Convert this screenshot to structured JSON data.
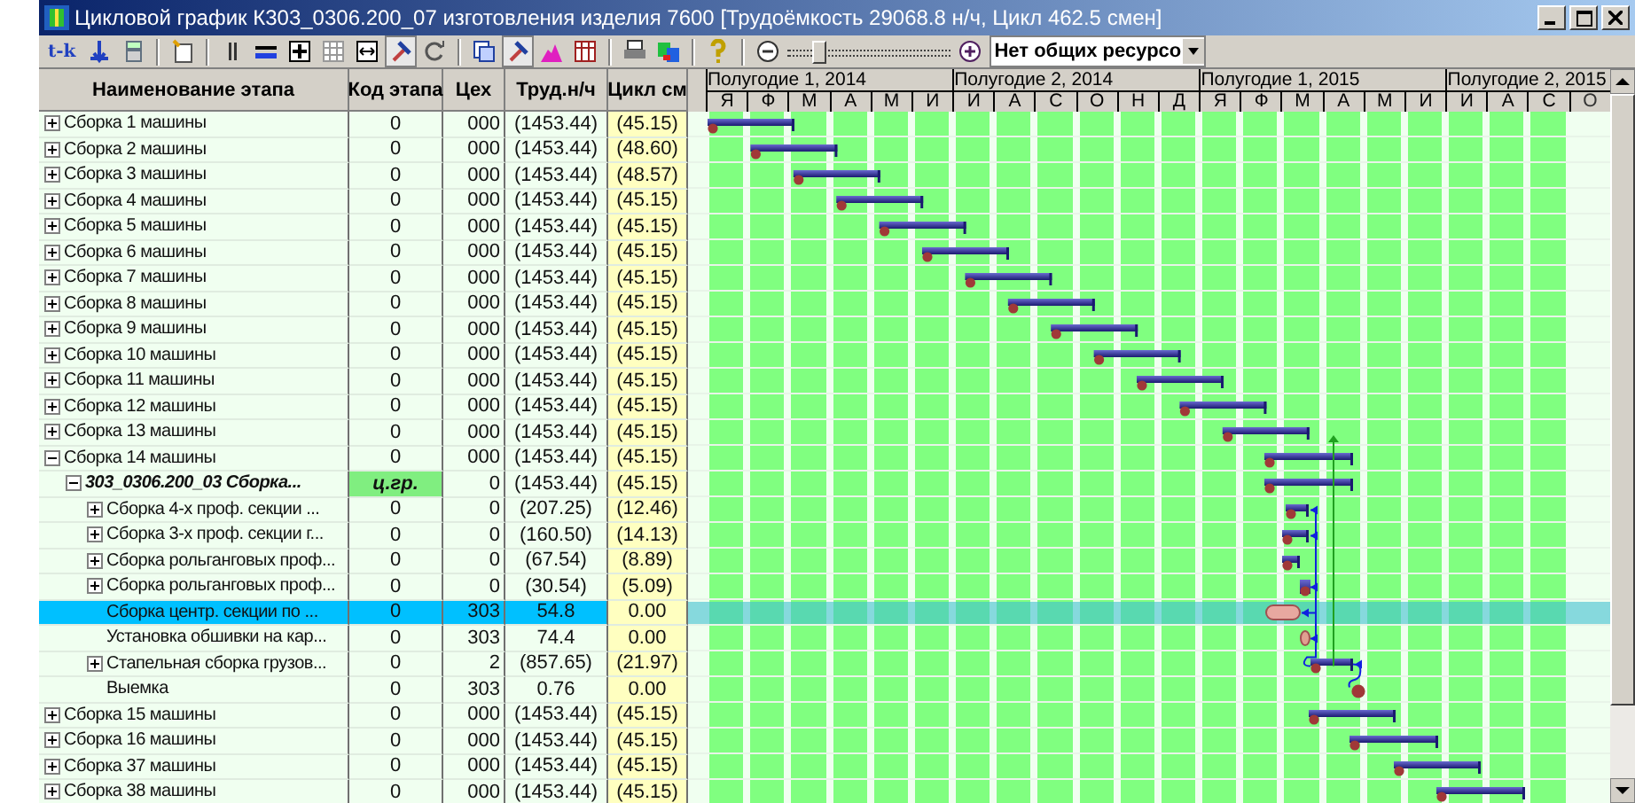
{
  "window": {
    "title": "Цикловой график К303_0306.200_07 изготовления изделия 7600   [Трудоёмкость 29068.8 н/ч, Цикл 462.5 смен]"
  },
  "toolbar": {
    "label": "t-k",
    "zoom_slider": {
      "level": 0.15
    },
    "resource_dropdown": {
      "value": "Нет общих ресурсо"
    }
  },
  "table": {
    "columns": [
      "Наименование этапа",
      "Код этапа",
      "Цех",
      "Труд.н/ч",
      "Цикл см"
    ],
    "rows": [
      {
        "kind": "stage",
        "name": "Сборка 1 машины",
        "code": "0",
        "shop": "000",
        "labor": "(1453.44)",
        "cycle": "(45.15)",
        "expanded": false,
        "selected": false
      },
      {
        "kind": "stage",
        "name": "Сборка 2 машины",
        "code": "0",
        "shop": "000",
        "labor": "(1453.44)",
        "cycle": "(48.60)",
        "expanded": false,
        "selected": false
      },
      {
        "kind": "stage",
        "name": "Сборка 3 машины",
        "code": "0",
        "shop": "000",
        "labor": "(1453.44)",
        "cycle": "(48.57)",
        "expanded": false,
        "selected": false
      },
      {
        "kind": "stage",
        "name": "Сборка 4 машины",
        "code": "0",
        "shop": "000",
        "labor": "(1453.44)",
        "cycle": "(45.15)",
        "expanded": false,
        "selected": false
      },
      {
        "kind": "stage",
        "name": "Сборка 5 машины",
        "code": "0",
        "shop": "000",
        "labor": "(1453.44)",
        "cycle": "(45.15)",
        "expanded": false,
        "selected": false
      },
      {
        "kind": "stage",
        "name": "Сборка 6 машины",
        "code": "0",
        "shop": "000",
        "labor": "(1453.44)",
        "cycle": "(45.15)",
        "expanded": false,
        "selected": false
      },
      {
        "kind": "stage",
        "name": "Сборка 7 машины",
        "code": "0",
        "shop": "000",
        "labor": "(1453.44)",
        "cycle": "(45.15)",
        "expanded": false,
        "selected": false
      },
      {
        "kind": "stage",
        "name": "Сборка 8 машины",
        "code": "0",
        "shop": "000",
        "labor": "(1453.44)",
        "cycle": "(45.15)",
        "expanded": false,
        "selected": false
      },
      {
        "kind": "stage",
        "name": "Сборка 9 машины",
        "code": "0",
        "shop": "000",
        "labor": "(1453.44)",
        "cycle": "(45.15)",
        "expanded": false,
        "selected": false
      },
      {
        "kind": "stage",
        "name": "Сборка 10 машины",
        "code": "0",
        "shop": "000",
        "labor": "(1453.44)",
        "cycle": "(45.15)",
        "expanded": false,
        "selected": false
      },
      {
        "kind": "stage",
        "name": "Сборка 11 машины",
        "code": "0",
        "shop": "000",
        "labor": "(1453.44)",
        "cycle": "(45.15)",
        "expanded": false,
        "selected": false
      },
      {
        "kind": "stage",
        "name": "Сборка 12 машины",
        "code": "0",
        "shop": "000",
        "labor": "(1453.44)",
        "cycle": "(45.15)",
        "expanded": false,
        "selected": false
      },
      {
        "kind": "stage",
        "name": "Сборка 13 машины",
        "code": "0",
        "shop": "000",
        "labor": "(1453.44)",
        "cycle": "(45.15)",
        "expanded": false,
        "selected": false
      },
      {
        "kind": "stage",
        "name": "Сборка 14 машины",
        "code": "0",
        "shop": "000",
        "labor": "(1453.44)",
        "cycle": "(45.15)",
        "expanded": true,
        "selected": false,
        "children": [
          {
            "kind": "group",
            "name": "303_0306.200_03 Сборка...",
            "code": "ц.гр.",
            "shop": "0",
            "labor": "(1453.44)",
            "cycle": "(45.15)",
            "expanded": true,
            "selected": false,
            "children": [
              {
                "kind": "stage",
                "name": "Сборка 4-х проф. секции ...",
                "code": "0",
                "shop": "0",
                "labor": "(207.25)",
                "cycle": "(12.46)",
                "expanded": false,
                "selected": false
              },
              {
                "kind": "stage",
                "name": "Сборка 3-х проф. секции г...",
                "code": "0",
                "shop": "0",
                "labor": "(160.50)",
                "cycle": "(14.13)",
                "expanded": false,
                "selected": false
              },
              {
                "kind": "stage",
                "name": "Сборка рольганговых проф...",
                "code": "0",
                "shop": "0",
                "labor": "(67.54)",
                "cycle": "(8.89)",
                "expanded": false,
                "selected": false
              },
              {
                "kind": "stage",
                "name": "Сборка рольганговых проф...",
                "code": "0",
                "shop": "0",
                "labor": "(30.54)",
                "cycle": "(5.09)",
                "expanded": false,
                "selected": false
              },
              {
                "kind": "stage",
                "name": "Сборка центр. секции по ...",
                "code": "0",
                "shop": "303",
                "labor": "54.8",
                "cycle": "0.00",
                "selected": true
              },
              {
                "kind": "stage",
                "name": "Установка обшивки на кар...",
                "code": "0",
                "shop": "303",
                "labor": "74.4",
                "cycle": "0.00",
                "selected": false
              },
              {
                "kind": "stage",
                "name": "Стапельная сборка грузов...",
                "code": "0",
                "shop": "2",
                "labor": "(857.65)",
                "cycle": "(21.97)",
                "expanded": false,
                "selected": false
              },
              {
                "kind": "stage",
                "name": "Выемка",
                "code": "0",
                "shop": "303",
                "labor": "0.76",
                "cycle": "0.00",
                "selected": false
              }
            ]
          }
        ]
      },
      {
        "kind": "stage",
        "name": "Сборка 15 машины",
        "code": "0",
        "shop": "000",
        "labor": "(1453.44)",
        "cycle": "(45.15)",
        "expanded": false,
        "selected": false
      },
      {
        "kind": "stage",
        "name": "Сборка 16 машины",
        "code": "0",
        "shop": "000",
        "labor": "(1453.44)",
        "cycle": "(45.15)",
        "expanded": false,
        "selected": false
      },
      {
        "kind": "stage",
        "name": "Сборка 37 машины",
        "code": "0",
        "shop": "000",
        "labor": "(1453.44)",
        "cycle": "(45.15)",
        "expanded": false,
        "selected": false
      },
      {
        "kind": "stage",
        "name": "Сборка 38 машины",
        "code": "0",
        "shop": "000",
        "labor": "(1453.44)",
        "cycle": "(45.15)",
        "expanded": false,
        "selected": false
      }
    ]
  },
  "timeline": {
    "periods": [
      "Полугодие 1, 2014",
      "Полугодие 2, 2014",
      "Полугодие 1, 2015",
      "Полугодие 2, 2015"
    ],
    "months": [
      {
        "label": "Я",
        "highlighted": true
      },
      {
        "label": "Ф",
        "highlighted": true
      },
      {
        "label": "М",
        "highlighted": true
      },
      {
        "label": "А",
        "highlighted": true
      },
      {
        "label": "М",
        "highlighted": true
      },
      {
        "label": "И",
        "highlighted": true
      },
      {
        "label": "И",
        "highlighted": true
      },
      {
        "label": "А",
        "highlighted": true
      },
      {
        "label": "С",
        "highlighted": true
      },
      {
        "label": "О",
        "highlighted": true
      },
      {
        "label": "Н",
        "highlighted": true
      },
      {
        "label": "Д",
        "highlighted": true
      },
      {
        "label": "Я",
        "highlighted": true
      },
      {
        "label": "Ф",
        "highlighted": true
      },
      {
        "label": "М",
        "highlighted": true
      },
      {
        "label": "А",
        "highlighted": true
      },
      {
        "label": "М",
        "highlighted": true
      },
      {
        "label": "И",
        "highlighted": true
      },
      {
        "label": "И",
        "highlighted": true
      },
      {
        "label": "А",
        "highlighted": true
      },
      {
        "label": "С",
        "highlighted": true
      },
      {
        "label": "О",
        "highlighted": false
      }
    ]
  }
}
